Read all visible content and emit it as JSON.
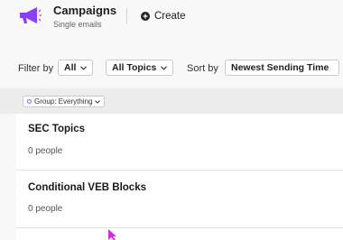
{
  "header": {
    "title": "Campaigns",
    "subtitle": "Single emails",
    "create_label": "Create",
    "accent_color": "#8a3ff3"
  },
  "filters": {
    "filter_by_label": "Filter by",
    "filter_value": "All",
    "topics_value": "All Topics",
    "sort_by_label": "Sort by",
    "sort_value": "Newest Sending Time"
  },
  "group": {
    "chip_label": "Group: Everything"
  },
  "campaigns": [
    {
      "name": "SEC Topics",
      "count": "0 people"
    },
    {
      "name": "Conditional VEB Blocks",
      "count": "0 people"
    }
  ]
}
